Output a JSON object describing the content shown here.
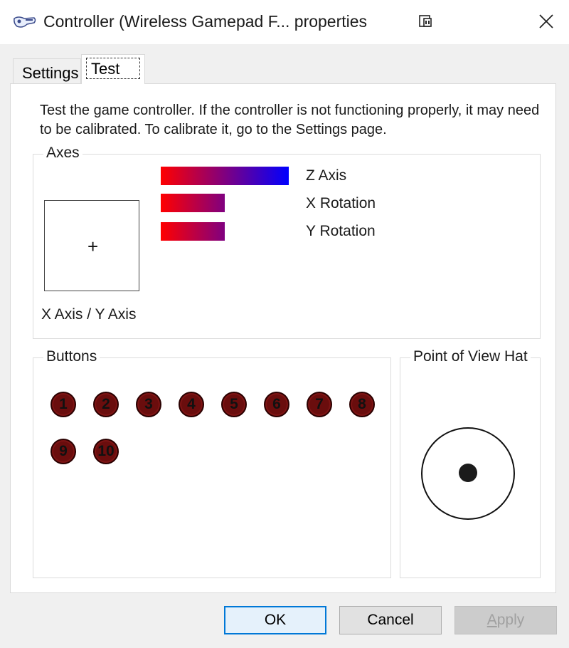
{
  "window": {
    "title": "Controller (Wireless Gamepad F... properties",
    "icons": {
      "app": "gamepad-icon",
      "help": "context-help-icon",
      "close": "close-icon"
    }
  },
  "tabs": [
    {
      "label": "Settings",
      "active": false
    },
    {
      "label": "Test",
      "active": true
    }
  ],
  "intro_text": "Test the game controller.  If the controller is not functioning properly, it may need to be calibrated.  To calibrate it, go to the Settings page.",
  "axes": {
    "title": "Axes",
    "xy_label": "X Axis / Y Axis",
    "xy_crosshair": "+",
    "bars": [
      {
        "label": "Z Axis",
        "level": 1.0
      },
      {
        "label": "X Rotation",
        "level": 0.5
      },
      {
        "label": "Y Rotation",
        "level": 0.5
      }
    ],
    "gradient_colors": {
      "start": "#ff0000",
      "end": "#0000ff"
    }
  },
  "buttons": {
    "title": "Buttons",
    "items": [
      "1",
      "2",
      "3",
      "4",
      "5",
      "6",
      "7",
      "8",
      "9",
      "10"
    ],
    "color": "#6a0d0d"
  },
  "pov": {
    "title": "Point of View Hat"
  },
  "dialog_buttons": {
    "ok": "OK",
    "cancel": "Cancel",
    "apply_first": "A",
    "apply_rest": "pply"
  }
}
